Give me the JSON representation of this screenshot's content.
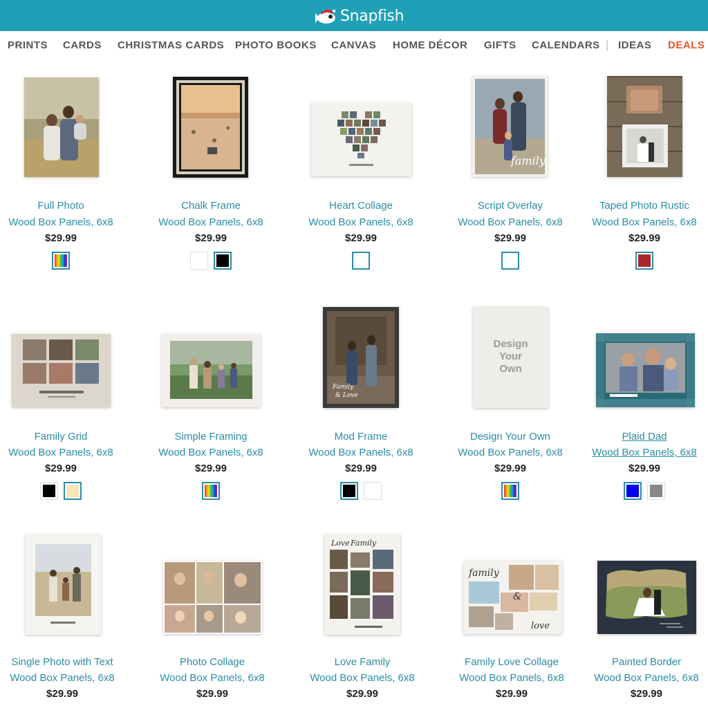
{
  "header": {
    "brand": "Snapfish",
    "bg": "#1fa0b6"
  },
  "nav": [
    {
      "label": "PRINTS"
    },
    {
      "label": "CARDS"
    },
    {
      "label": "CHRISTMAS CARDS"
    },
    {
      "label": "PHOTO BOOKS"
    },
    {
      "label": "CANVAS"
    },
    {
      "label": "HOME DÉCOR"
    },
    {
      "label": "GIFTS"
    },
    {
      "label": "CALENDARS"
    },
    {
      "label": "IDEAS"
    },
    {
      "label": "DEALS"
    }
  ],
  "nav_separator": "|",
  "products": [
    {
      "name": "Full Photo",
      "sub": "Wood Box Panels, 6x8",
      "price": "$29.99",
      "swatches": [
        "rainbow"
      ]
    },
    {
      "name": "Chalk Frame",
      "sub": "Wood Box Panels, 6x8",
      "price": "$29.99",
      "swatches": [
        "#ffffff",
        "#000000"
      ]
    },
    {
      "name": "Heart Collage",
      "sub": "Wood Box Panels, 6x8",
      "price": "$29.99",
      "swatches": [
        "#ffffff"
      ]
    },
    {
      "name": "Script Overlay",
      "sub": "Wood Box Panels, 6x8",
      "price": "$29.99",
      "swatches": [
        "#ffffff"
      ]
    },
    {
      "name": "Taped Photo Rustic",
      "sub": "Wood Box Panels, 6x8",
      "price": "$29.99",
      "swatches": [
        "#a8282a"
      ]
    },
    {
      "name": "Family Grid",
      "sub": "Wood Box Panels, 6x8",
      "price": "$29.99",
      "swatches": [
        "#000000",
        "#fbe4b8"
      ]
    },
    {
      "name": "Simple Framing",
      "sub": "Wood Box Panels, 6x8",
      "price": "$29.99",
      "swatches": [
        "rainbow"
      ]
    },
    {
      "name": "Mod Frame",
      "sub": "Wood Box Panels, 6x8",
      "price": "$29.99",
      "swatches": [
        "#000000",
        "#ffffff"
      ]
    },
    {
      "name": "Design Your Own",
      "sub": "Wood Box Panels, 6x8",
      "price": "$29.99",
      "swatches": [
        "rainbow"
      ],
      "thumb_text": [
        "Design",
        "Your",
        "Own"
      ]
    },
    {
      "name": "Plaid Dad",
      "sub": "Wood Box Panels, 6x8",
      "price": "$29.99",
      "swatches": [
        "#0000ee",
        "#888888"
      ]
    },
    {
      "name": "Single Photo with Text",
      "sub": "Wood Box Panels, 6x8",
      "price": "$29.99",
      "swatches": []
    },
    {
      "name": "Photo Collage",
      "sub": "Wood Box Panels, 6x8",
      "price": "$29.99",
      "swatches": []
    },
    {
      "name": "Love Family",
      "sub": "Wood Box Panels, 6x8",
      "price": "$29.99",
      "swatches": []
    },
    {
      "name": "Family Love Collage",
      "sub": "Wood Box Panels, 6x8",
      "price": "$29.99",
      "swatches": []
    },
    {
      "name": "Painted Border",
      "sub": "Wood Box Panels, 6x8",
      "price": "$29.99",
      "swatches": []
    }
  ]
}
